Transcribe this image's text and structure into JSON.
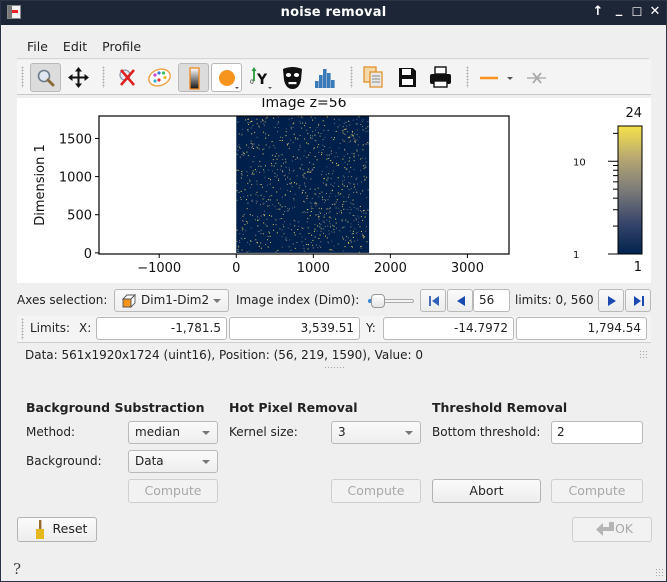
{
  "window": {
    "title": "noise removal",
    "controls": {
      "keep_above": "↑",
      "minimize": "_",
      "maximize": "☐",
      "close": "✕"
    }
  },
  "menu": [
    "File",
    "Edit",
    "Profile"
  ],
  "toolbar": {
    "buttons": [
      {
        "name": "zoom-mode",
        "icon": "magnifier-icon",
        "pressed": true
      },
      {
        "name": "pan-mode",
        "icon": "move-arrows-icon",
        "pressed": false
      },
      {
        "name": "reset-zoom",
        "icon": "zoom-reset-icon",
        "pressed": false
      },
      {
        "name": "colormap",
        "icon": "palette-icon",
        "pressed": false
      },
      {
        "name": "colorbar-toggle",
        "icon": "colorbar-icon",
        "pressed": true
      },
      {
        "name": "aspect-ratio",
        "icon": "circle-icon",
        "pressed": false,
        "color": "#f7941d"
      },
      {
        "name": "y-axis-direction",
        "icon": "y-axis-icon",
        "pressed": false
      },
      {
        "name": "mask-tools",
        "icon": "mask-icon",
        "pressed": false
      },
      {
        "name": "histogram",
        "icon": "histogram-icon",
        "pressed": false
      },
      {
        "name": "copy",
        "icon": "copy-icon",
        "pressed": false
      },
      {
        "name": "save",
        "icon": "floppy-disk-icon",
        "pressed": false
      },
      {
        "name": "print",
        "icon": "printer-icon",
        "pressed": false
      },
      {
        "name": "profile-line",
        "icon": "line-profile-icon",
        "pressed": false
      },
      {
        "name": "clear-profile",
        "icon": "clear-profile-icon",
        "pressed": false
      }
    ]
  },
  "plot": {
    "title": "Image z=56",
    "ylabel": "Dimension 1",
    "xticks": [
      "−1000",
      "0",
      "1000",
      "2000",
      "3000"
    ],
    "yticks": [
      "0",
      "500",
      "1000",
      "1500"
    ],
    "colorbar": {
      "max_label": "24",
      "min_label": "1",
      "tick_10": "10",
      "tick_1": "1",
      "scale": "log",
      "colormap": "cividis"
    }
  },
  "chart_data": {
    "type": "heatmap",
    "title": "Image z=56",
    "xlabel": "",
    "ylabel": "Dimension 1",
    "xlim": [
      -1781.5,
      3539.51
    ],
    "ylim": [
      -14.7972,
      1794.54
    ],
    "image_extent": {
      "x": [
        0,
        1724
      ],
      "y": [
        0,
        1920
      ]
    },
    "xticks": [
      -1000,
      0,
      1000,
      2000,
      3000
    ],
    "yticks": [
      0,
      500,
      1000,
      1500
    ],
    "colorbar": {
      "min": 1,
      "max": 24,
      "scale": "log",
      "colormap": "cividis"
    },
    "grid": false
  },
  "axes_selection": {
    "label": "Axes selection:",
    "value": "Dim1-Dim2",
    "image_index_label": "Image index (Dim0):",
    "slider_fraction": 0.1,
    "index_value": "56",
    "limits_text": "limits: 0, 560"
  },
  "limits": {
    "label": "Limits:",
    "x_label": "X:",
    "x_min": "-1,781.5",
    "x_max": "3,539.51",
    "y_label": "Y:",
    "y_min": "-14.7972",
    "y_max": "1,794.54"
  },
  "status": "Data: 561x1920x1724 (uint16), Position: (56, 219, 1590), Value: 0",
  "background_substraction": {
    "title": "Background Substraction",
    "method_label": "Method:",
    "method_value": "median",
    "background_label": "Background:",
    "background_value": "Data",
    "compute_label": "Compute"
  },
  "hot_pixel": {
    "title": "Hot Pixel Removal",
    "kernel_label": "Kernel size:",
    "kernel_value": "3",
    "compute_label": "Compute"
  },
  "threshold": {
    "title": "Threshold Removal",
    "bottom_label": "Bottom threshold:",
    "bottom_value": "2",
    "abort_label": "Abort",
    "compute_label": "Compute"
  },
  "footer": {
    "reset_label": "Reset",
    "ok_label": "OK",
    "help": "?"
  }
}
